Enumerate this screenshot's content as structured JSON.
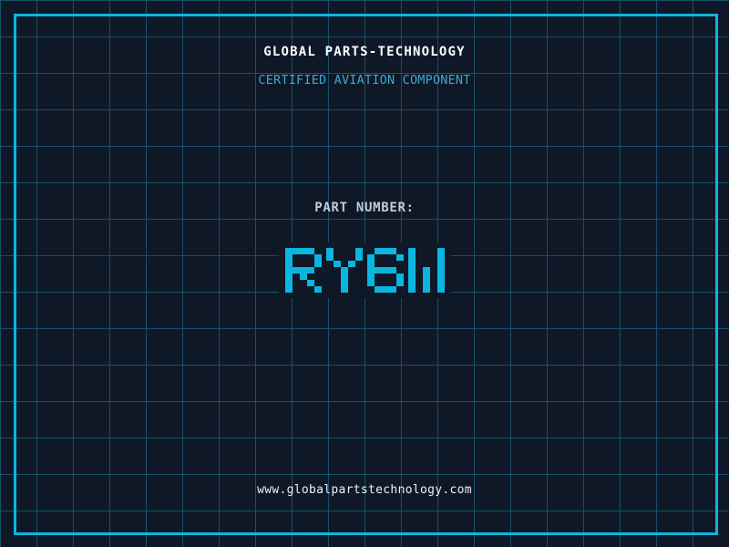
{
  "header": {
    "title": "GLOBAL PARTS-TECHNOLOGY",
    "subtitle": "CERTIFIED AVIATION COMPONENT"
  },
  "part": {
    "label": "PART NUMBER:",
    "number": "RY6W"
  },
  "footer": {
    "url": "www.globalpartstechnology.com"
  },
  "colors": {
    "background": "#0f1826",
    "grid_line": "#17506a",
    "frame_accent": "#0ab6e0",
    "part_number_text": "#0ab6e0",
    "subtitle_text": "#39a9d1",
    "title_text": "#fdfdfd",
    "label_text": "#c6cbd5",
    "url_text": "#eef1f5"
  }
}
